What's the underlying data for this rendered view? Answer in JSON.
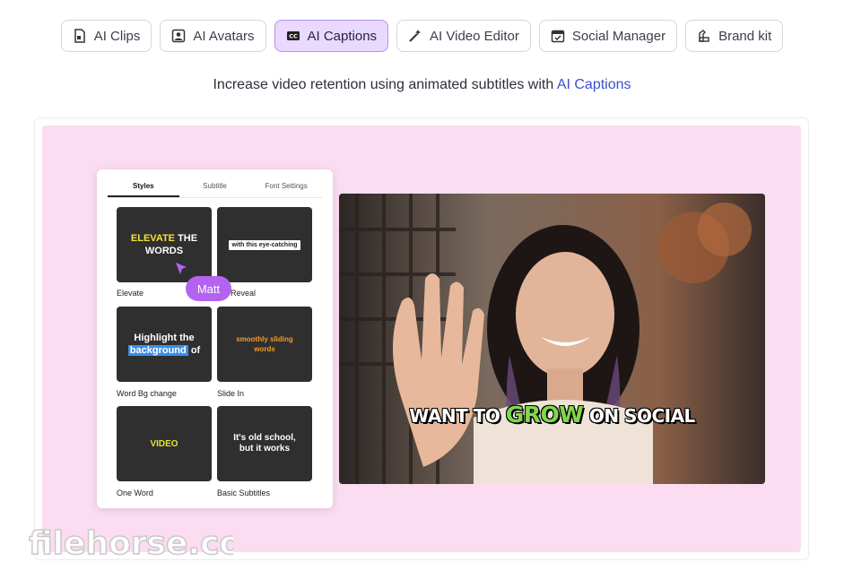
{
  "tabs": [
    {
      "label": "AI Clips",
      "icon": "clip-file-icon",
      "active": false
    },
    {
      "label": "AI Avatars",
      "icon": "avatar-icon",
      "active": false
    },
    {
      "label": "AI Captions",
      "icon": "cc-icon",
      "active": true
    },
    {
      "label": "AI Video Editor",
      "icon": "magic-wand-icon",
      "active": false
    },
    {
      "label": "Social Manager",
      "icon": "calendar-icon",
      "active": false
    },
    {
      "label": "Brand kit",
      "icon": "brand-kit-icon",
      "active": false
    }
  ],
  "subtitle": {
    "text": "Increase video retention using animated subtitles with ",
    "link": "AI Captions"
  },
  "styles_panel": {
    "tabs": [
      "Styles",
      "Subtitle",
      "Font Settings"
    ],
    "styles": [
      {
        "label": "Elevate",
        "preview_highlight": "ELEVATE",
        "preview_rest": "THE",
        "preview_line2": "WORDS"
      },
      {
        "label": "t Reveal",
        "preview": "with this eye-catching"
      },
      {
        "label": "Word Bg change",
        "preview_line1": "Highlight the",
        "preview_highlight": "background",
        "preview_rest": "of"
      },
      {
        "label": "Slide In",
        "preview_line1": "smoothly sliding",
        "preview_line2": "words"
      },
      {
        "label": "One Word",
        "preview": "VIDEO"
      },
      {
        "label": "Basic Subtitles",
        "preview_line1": "It's old school,",
        "preview_line2": "but it works"
      }
    ],
    "cursor_user": "Matt"
  },
  "video": {
    "caption_before": "WANT TO ",
    "caption_highlight": "GROW",
    "caption_after": " ON SOCIAL"
  },
  "watermark": "filehorse.com",
  "colors": {
    "accent_purple": "#b463f0",
    "active_tab_bg": "#e9d9ff",
    "link_blue": "#3b4fd0",
    "panel_pink": "#fcdcf1",
    "caption_green": "#7fd84a"
  }
}
